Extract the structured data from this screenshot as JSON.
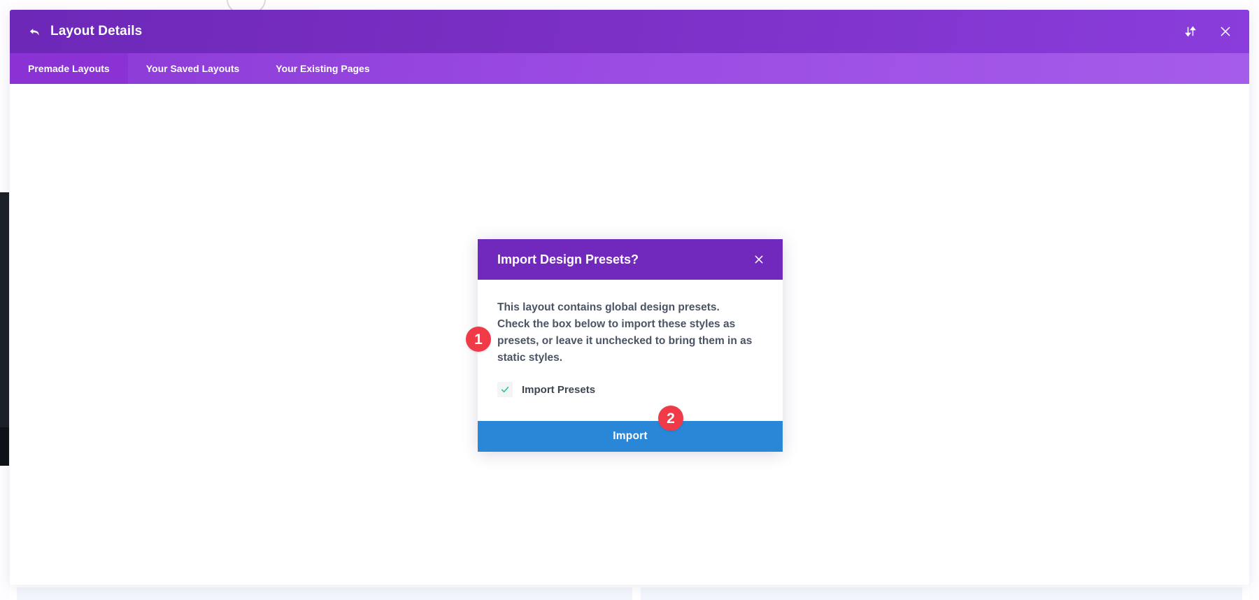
{
  "window": {
    "title": "Layout Details",
    "back_icon": "back-arrow-icon",
    "sort_icon": "sort-updown-icon",
    "close_icon": "close-icon"
  },
  "tabs": [
    {
      "label": "Premade Layouts",
      "active": true
    },
    {
      "label": "Your Saved Layouts",
      "active": false
    },
    {
      "label": "Your Existing Pages",
      "active": false
    }
  ],
  "dialog": {
    "title": "Import Design Presets?",
    "close_icon": "close-icon",
    "body_text": "This layout contains global design presets. Check the box below to import these styles as presets, or leave it unchecked to bring them in as static styles.",
    "checkbox": {
      "label": "Import Presets",
      "checked": true,
      "check_icon": "checkmark-icon"
    },
    "import_button": "Import"
  },
  "annotations": [
    {
      "number": "1",
      "target": "import-presets-checkbox"
    },
    {
      "number": "2",
      "target": "import-button"
    }
  ],
  "colors": {
    "header_purple": "#7b2fc4",
    "tab_purple": "#9b4ce3",
    "tab_active_purple": "#8a32d4",
    "dialog_purple": "#7128bd",
    "import_blue": "#2a87d8",
    "check_green": "#1fc39b",
    "badge_red": "#f03a47"
  }
}
